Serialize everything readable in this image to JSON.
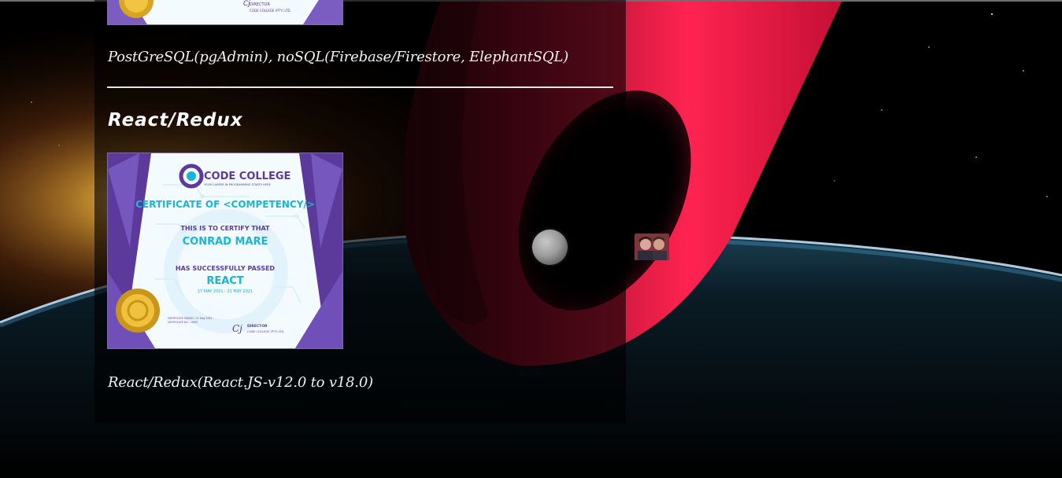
{
  "colors": {
    "accent_red": "#ff1f4b",
    "background": "#000000",
    "cert_purple": "#5b3a9c",
    "cert_cyan": "#16b6d4"
  },
  "sections": [
    {
      "caption": "PostGreSQL(pgAdmin), noSQL(Firebase/Firestore, ElephantSQL)",
      "certificate": {
        "director_label": "DIRECTOR",
        "director_org": "CODE COLLEGE (PTY) LTD."
      }
    },
    {
      "title": "React/Redux",
      "caption": "React/Redux(React.JS-v12.0 to v18.0)",
      "certificate": {
        "brand": "CODE COLLEGE",
        "tagline": "YOUR CAREER IN PROGRAMMING STARTS HERE",
        "heading": "CERTIFICATE OF <COMPETENCY/>",
        "certify_text": "THIS IS TO CERTIFY THAT",
        "name": "CONRAD MARE",
        "passed_text": "HAS SUCCESSFULLY PASSED",
        "course": "REACT",
        "dates": "17 MAY 2021 - 21 MAY 2021",
        "issue_info_1": "CERTIFICATE ISSUED : 21 May 2021",
        "issue_info_2": "CERTIFICATE NO. : 0095",
        "director_label": "DIRECTOR",
        "director_org": "CODE COLLEGE (PTY) LTD."
      }
    }
  ],
  "icons": {
    "moon": "moon-icon",
    "avatar": "avatar-photo"
  }
}
